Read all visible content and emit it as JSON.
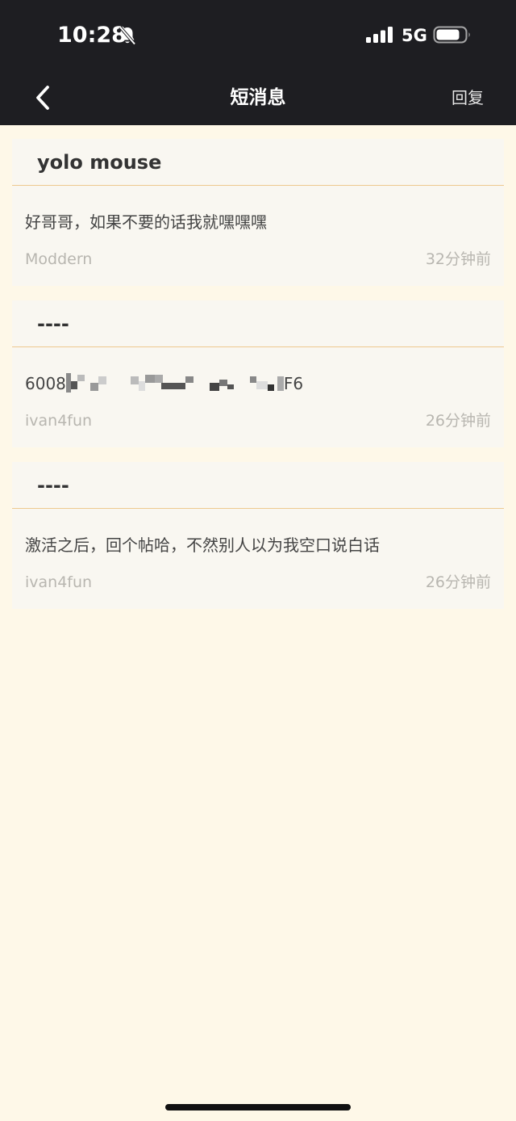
{
  "status_bar": {
    "time": "10:28",
    "network": "5G",
    "icons": [
      "bell-slash-icon",
      "signal-icon",
      "battery-icon"
    ]
  },
  "nav": {
    "title": "短消息",
    "reply_label": "回复",
    "back_icon": "chevron-left-icon"
  },
  "messages": [
    {
      "title": "yolo mouse",
      "text": "好哥哥，如果不要的话我就嘿嘿嘿",
      "author": "Moddern",
      "time": "32分钟前"
    },
    {
      "title": "----",
      "text_prefix": "6008",
      "text_suffix": "F6",
      "author": "ivan4fun",
      "time": "26分钟前"
    },
    {
      "title": "----",
      "text": "激活之后，回个帖哈，不然别人以为我空口说白话",
      "author": "ivan4fun",
      "time": "26分钟前"
    }
  ],
  "colors": {
    "header_bg": "#1e1e22",
    "page_bg": "#fef8e8",
    "card_bg": "#f9f7f1",
    "divider": "#eec98f",
    "meta_text": "#b8b6b0"
  }
}
